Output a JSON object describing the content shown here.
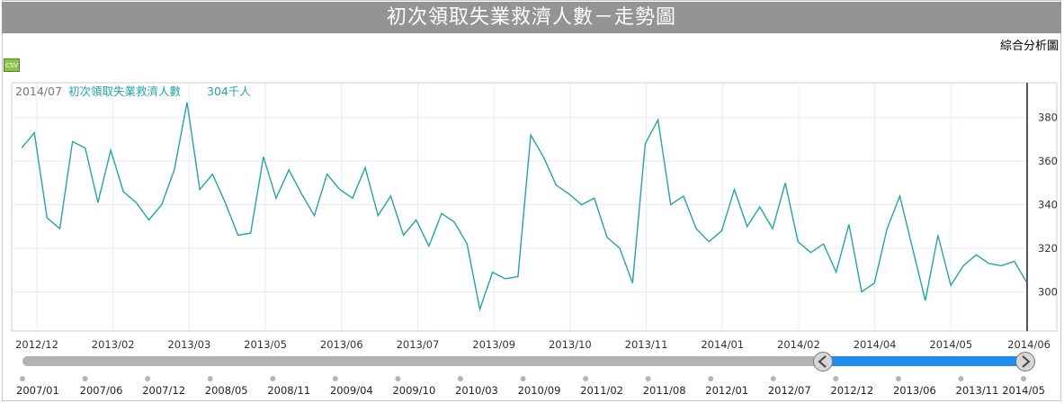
{
  "header": {
    "title": "初次領取失業救濟人數－走勢圖",
    "analysis_link": "綜合分析圖"
  },
  "toolbar": {
    "csv_label": "CSV"
  },
  "tooltip": {
    "date": "2014/07",
    "series": "初次領取失業救濟人數",
    "value": "304千人"
  },
  "navigator": {
    "labels": [
      "2007/01",
      "2007/06",
      "2007/12",
      "2008/05",
      "2008/11",
      "2009/04",
      "2009/10",
      "2010/03",
      "2010/09",
      "2011/02",
      "2011/08",
      "2012/01",
      "2012/07",
      "2012/12",
      "2013/06",
      "2013/11",
      "2014/05"
    ],
    "selected_start": "2012/12",
    "selected_end": "2014/06"
  },
  "colors": {
    "line": "#24a3a8",
    "navigator_fill": "#1e8cf0",
    "navigator_track": "#b3b3b3",
    "title_bar": "#949494"
  },
  "chart_data": {
    "type": "line",
    "title": "初次領取失業救濟人數－走勢圖",
    "series": [
      {
        "name": "初次領取失業救濟人數",
        "values": [
          366,
          373,
          334,
          329,
          369,
          366,
          341,
          365,
          346,
          341,
          333,
          340,
          356,
          387,
          347,
          354,
          341,
          326,
          327,
          362,
          343,
          356,
          345,
          335,
          354,
          347,
          343,
          357,
          335,
          344,
          326,
          333,
          321,
          336,
          332,
          322,
          292,
          309,
          306,
          307,
          372,
          362,
          349,
          345,
          340,
          343,
          325,
          320,
          304,
          368,
          379,
          340,
          344,
          329,
          323,
          328,
          347,
          330,
          339,
          329,
          350,
          323,
          318,
          322,
          309,
          331,
          300,
          304,
          329,
          344,
          320,
          296,
          326,
          303,
          312,
          317,
          313,
          312,
          314,
          304
        ]
      }
    ],
    "x_tick_labels": [
      "2012/12",
      "2013/02",
      "2013/03",
      "2013/05",
      "2013/06",
      "2013/07",
      "2013/09",
      "2013/10",
      "2013/11",
      "2014/01",
      "2014/02",
      "2014/04",
      "2014/05",
      "2014/06"
    ],
    "y_ticks": [
      300,
      320,
      340,
      360,
      380
    ],
    "ylim": [
      282,
      396
    ],
    "y_axis_position": "right",
    "grid": true,
    "units": "千人"
  }
}
